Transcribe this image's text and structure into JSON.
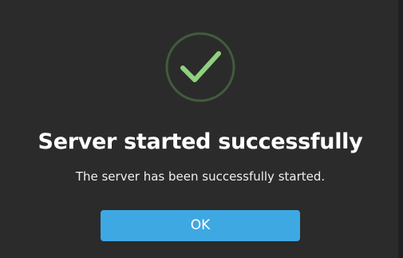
{
  "dialog": {
    "icon": "checkmark-circle-icon",
    "title": "Server started successfully",
    "message": "The server has been successfully started.",
    "ok_label": "OK"
  },
  "colors": {
    "background": "#2b2b2b",
    "icon_ring": "#425b3d",
    "icon_check": "#8fd07f",
    "button": "#3ea8e3",
    "text": "#ffffff"
  }
}
